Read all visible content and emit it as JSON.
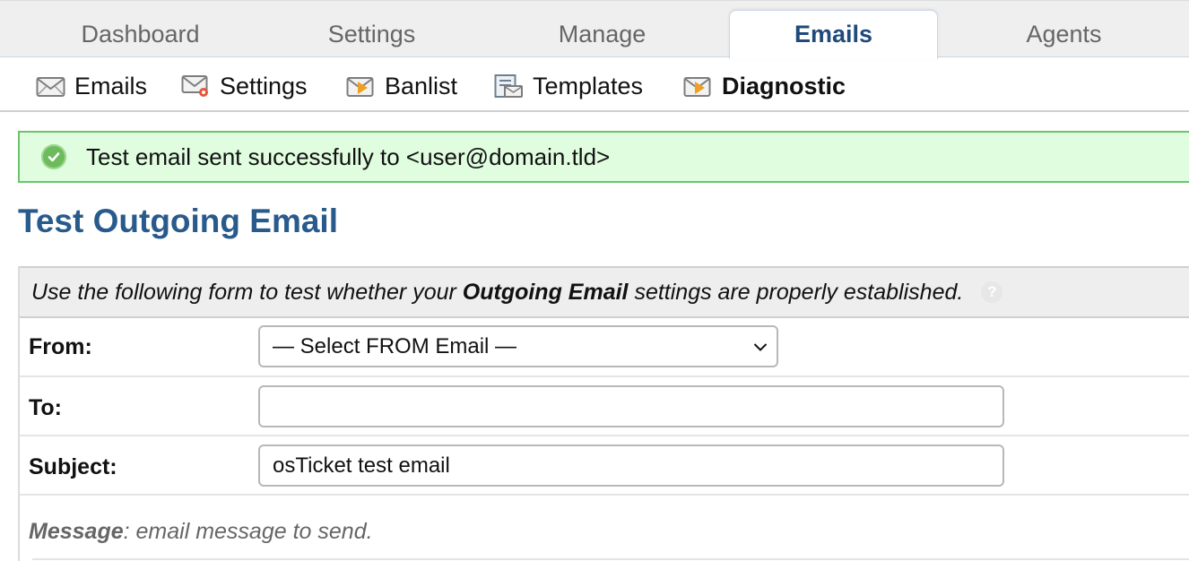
{
  "nav": {
    "tabs": [
      {
        "label": "Dashboard",
        "active": false
      },
      {
        "label": "Settings",
        "active": false
      },
      {
        "label": "Manage",
        "active": false
      },
      {
        "label": "Emails",
        "active": true
      },
      {
        "label": "Agents",
        "active": false
      }
    ]
  },
  "subnav": {
    "items": [
      {
        "label": "Emails",
        "icon": "envelope-icon",
        "active": false
      },
      {
        "label": "Settings",
        "icon": "email-settings-icon",
        "active": false
      },
      {
        "label": "Banlist",
        "icon": "banlist-icon",
        "active": false
      },
      {
        "label": "Templates",
        "icon": "templates-icon",
        "active": false
      },
      {
        "label": "Diagnostic",
        "icon": "diagnostic-icon",
        "active": true
      }
    ]
  },
  "notice": {
    "message": "Test email sent successfully to <user@domain.tld>",
    "icon": "check-circle-icon",
    "color": "#e0fde0"
  },
  "page": {
    "title": "Test Outgoing Email"
  },
  "form": {
    "description_pre": "Use the following form to test whether your ",
    "description_bold": "Outgoing Email",
    "description_post": " settings are properly established.",
    "help_icon": "?",
    "from": {
      "label": "From:",
      "selected": "— Select FROM Email —"
    },
    "to": {
      "label": "To:",
      "value": "",
      "placeholder": ""
    },
    "subject": {
      "label": "Subject:",
      "value": "osTicket test email"
    },
    "message": {
      "label": "Message",
      "hint": ": email message to send."
    }
  },
  "colors": {
    "accent": "#285b8c",
    "tab_active_text": "#1f4a7a",
    "success_border": "#6cc36c"
  }
}
